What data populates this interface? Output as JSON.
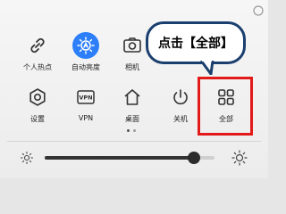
{
  "tiles": [
    {
      "label": "个人热点",
      "icon": "link-icon"
    },
    {
      "label": "自动亮度",
      "icon": "auto-brightness-icon",
      "active": true
    },
    {
      "label": "相机",
      "icon": "camera-icon"
    },
    {
      "label": "设置",
      "icon": "gear-icon"
    },
    {
      "label": "VPN",
      "icon": "vpn-icon"
    },
    {
      "label": "桌面",
      "icon": "home-icon"
    },
    {
      "label": "关机",
      "icon": "power-icon"
    },
    {
      "label": "全部",
      "icon": "grid-icon"
    }
  ],
  "vpn_icon_text": "VPN",
  "callout": {
    "text": "点击【全部】"
  },
  "pagination": {
    "current": 1,
    "total": 2
  },
  "brightness": {
    "level": 0.88
  },
  "colors": {
    "accent": "#2d7ff9",
    "highlight": "#e31a1a",
    "callout_border": "#1b3f6f"
  }
}
